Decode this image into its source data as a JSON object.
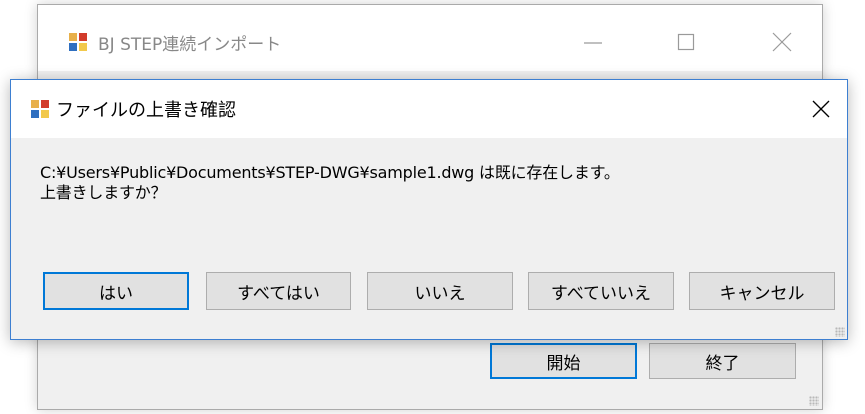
{
  "background_window": {
    "title": "BJ STEP連続インポート",
    "icon": "app-icon",
    "controls": [
      "minimize-icon",
      "maximize-icon",
      "close-icon"
    ],
    "buttons": {
      "start": "開始",
      "end": "終了"
    }
  },
  "dialog": {
    "title": "ファイルの上書き確認",
    "icon": "app-icon",
    "message_line1": "C:¥Users¥Public¥Documents¥STEP-DWG¥sample1.dwg は既に存在します。",
    "message_line2": "上書きしますか？",
    "buttons": {
      "yes": "はい",
      "yes_all": "すべてはい",
      "no": "いいえ",
      "no_all": "すべていいえ",
      "cancel": "キャンセル"
    }
  },
  "colors": {
    "focus_border": "#0078d7",
    "dialog_border": "#3d7fd1",
    "button_face": "#e1e1e1",
    "window_face": "#f0f0f0"
  }
}
